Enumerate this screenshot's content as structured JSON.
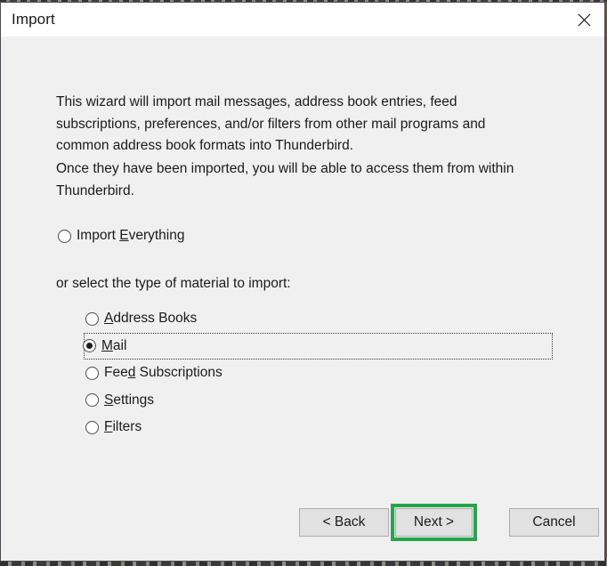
{
  "window": {
    "title": "Import",
    "close_icon": "close-icon"
  },
  "content": {
    "paragraph_1": "This wizard will import mail messages, address book entries, feed subscriptions, preferences, and/or filters from other mail programs and common address book formats into Thunderbird.",
    "paragraph_2": "Once they have been imported, you will be able to access them from within Thunderbird.",
    "import_everything": {
      "label_before": "Import ",
      "accelerator": "E",
      "label_after": "verything",
      "checked": false
    },
    "select_type_label": "or select the type of material to import:",
    "options": [
      {
        "label_before": "",
        "accelerator": "A",
        "label_after": "ddress Books",
        "checked": false,
        "focused": false
      },
      {
        "label_before": "",
        "accelerator": "M",
        "label_after": "ail",
        "checked": true,
        "focused": true
      },
      {
        "label_before": "Fee",
        "accelerator": "d",
        "label_after": " Subscriptions",
        "checked": false,
        "focused": false
      },
      {
        "label_before": "",
        "accelerator": "S",
        "label_after": "ettings",
        "checked": false,
        "focused": false
      },
      {
        "label_before": "",
        "accelerator": "F",
        "label_after": "ilters",
        "checked": false,
        "focused": false
      }
    ]
  },
  "footer": {
    "back_label": "< Back",
    "next_label": "Next >",
    "cancel_label": "Cancel"
  },
  "annotation": {
    "highlight_color": "#22a84a",
    "highlight_target": "Next >"
  }
}
